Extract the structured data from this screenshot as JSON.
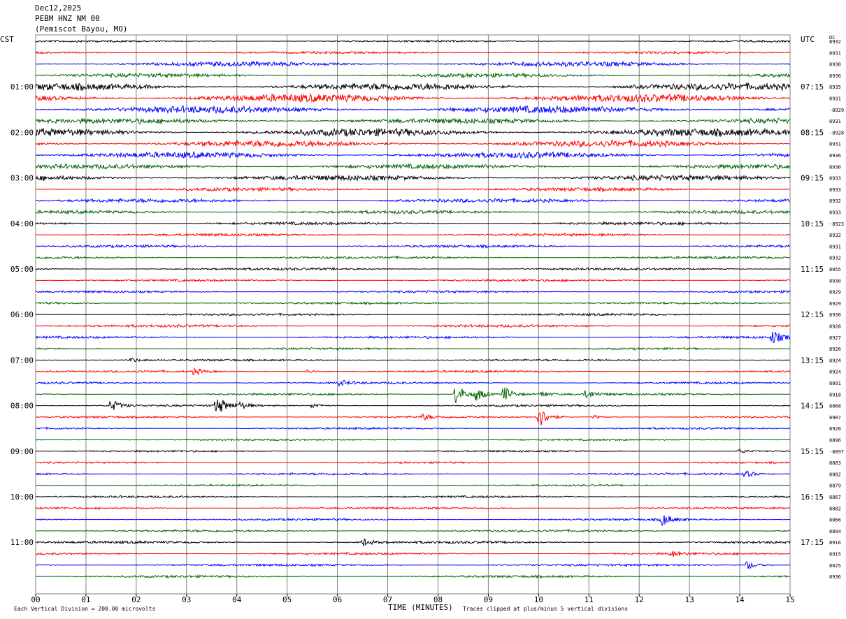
{
  "header": {
    "date": "Dec12,2025",
    "station": "PEBM HNZ NM 00",
    "location": "(Pemiscot Bayou, MO)"
  },
  "left_zone": "CST",
  "right_zone": "UTC",
  "dc_label": "DC",
  "footer": {
    "scale": "Each Vertical Division =  200.00 microvolts",
    "clip": "Traces clipped at plus/minus 5 vertical divisions",
    "xlabel": "TIME (MINUTES)"
  },
  "colors": {
    "trace": [
      "#000000",
      "#ff0000",
      "#0000ff",
      "#006400"
    ],
    "grid": "#808080"
  },
  "chart_data": {
    "type": "line",
    "title": "Dec12,2025 PEBM HNZ NM 00 (Pemiscot Bayou, MO)",
    "xlabel": "TIME (MINUTES)",
    "xlim": [
      0,
      15
    ],
    "x_ticks": [
      "00",
      "01",
      "02",
      "03",
      "04",
      "05",
      "06",
      "07",
      "08",
      "09",
      "10",
      "11",
      "12",
      "13",
      "14",
      "15"
    ],
    "left_time_labels": [
      "01:00",
      "02:00",
      "03:00",
      "04:00",
      "05:00",
      "06:00",
      "07:00",
      "08:00",
      "09:00",
      "10:00",
      "11:00"
    ],
    "right_time_labels": [
      "07:15",
      "08:15",
      "09:15",
      "10:15",
      "11:15",
      "12:15",
      "13:15",
      "14:15",
      "15:15",
      "16:15",
      "17:15"
    ],
    "first_labeled_row": 4,
    "rows_per_hour": 4,
    "row_count": 48,
    "dc_offsets": [
      "8932",
      "8931",
      "8930",
      "8930",
      "8935",
      "8931",
      "-8929",
      "8931",
      "-8928",
      "8931",
      "8936",
      "8930",
      "8933",
      "8933",
      "8932",
      "8933",
      "-8923",
      "8932",
      "8931",
      "8932",
      "8055",
      "8930",
      "8929",
      "8929",
      "8930",
      "8928",
      "8927",
      "8926",
      "8924",
      "8924",
      "8091",
      "8918",
      "8068",
      "8907",
      "8920",
      "8896",
      "-8897",
      "8883",
      "8082",
      "8879",
      "8867",
      "8882",
      "8066",
      "8894",
      "8916",
      "8915",
      "8025",
      "8936"
    ],
    "amplitude_index": [
      1.3,
      1.6,
      3.2,
      2.6,
      4.8,
      5.4,
      4.9,
      3.5,
      5.2,
      4.4,
      4.0,
      3.2,
      3.6,
      2.4,
      2.6,
      2.2,
      2.0,
      1.8,
      1.7,
      1.6,
      1.6,
      1.5,
      1.5,
      1.4,
      1.5,
      1.8,
      1.6,
      1.4,
      1.3,
      1.4,
      1.4,
      1.4,
      1.4,
      1.3,
      1.3,
      1.2,
      1.2,
      1.2,
      1.5,
      1.2,
      1.4,
      1.3,
      1.4,
      1.5,
      1.7,
      1.5,
      1.5,
      1.6
    ],
    "events": [
      {
        "row": 26,
        "minute": 14.65,
        "amplitude": 9
      },
      {
        "row": 28,
        "minute": 1.9,
        "amplitude": 3
      },
      {
        "row": 29,
        "minute": 3.15,
        "amplitude": 5
      },
      {
        "row": 29,
        "minute": 5.4,
        "amplitude": 3
      },
      {
        "row": 30,
        "minute": 6.05,
        "amplitude": 4
      },
      {
        "row": 31,
        "minute": 8.35,
        "amplitude": 16
      },
      {
        "row": 31,
        "minute": 8.75,
        "amplitude": 10
      },
      {
        "row": 31,
        "minute": 9.3,
        "amplitude": 12
      },
      {
        "row": 31,
        "minute": 10.05,
        "amplitude": 4
      },
      {
        "row": 31,
        "minute": 10.95,
        "amplitude": 6
      },
      {
        "row": 32,
        "minute": 1.5,
        "amplitude": 9
      },
      {
        "row": 32,
        "minute": 3.6,
        "amplitude": 14
      },
      {
        "row": 32,
        "minute": 4.05,
        "amplitude": 4
      },
      {
        "row": 32,
        "minute": 5.5,
        "amplitude": 4
      },
      {
        "row": 33,
        "minute": 7.7,
        "amplitude": 4
      },
      {
        "row": 33,
        "minute": 10.0,
        "amplitude": 16
      },
      {
        "row": 33,
        "minute": 11.1,
        "amplitude": 3
      },
      {
        "row": 36,
        "minute": 14.0,
        "amplitude": 3
      },
      {
        "row": 38,
        "minute": 14.1,
        "amplitude": 5
      },
      {
        "row": 42,
        "minute": 12.45,
        "amplitude": 9
      },
      {
        "row": 44,
        "minute": 6.5,
        "amplitude": 6
      },
      {
        "row": 45,
        "minute": 12.65,
        "amplitude": 4
      },
      {
        "row": 46,
        "minute": 14.15,
        "amplitude": 7
      }
    ]
  }
}
